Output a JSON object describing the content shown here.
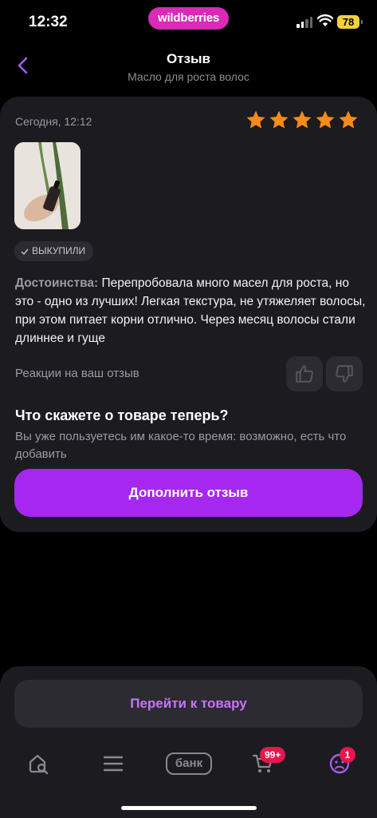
{
  "status_bar": {
    "time": "12:32",
    "brand": "wildberries",
    "battery": "78"
  },
  "header": {
    "title": "Отзыв",
    "subtitle": "Масло для роста волос"
  },
  "review": {
    "date": "Сегодня, 12:12",
    "rating": 5,
    "badge": "ВЫКУПИЛИ",
    "pros_label": "Достоинства:",
    "pros_text": " Перепробовала много масел для роста, но это - одно из лучших! Легкая текстура, не утяжеляет волосы, при этом питает корни отлично. Через месяц волосы стали длиннее и гуще",
    "reactions_label": "Реакции на ваш отзыв"
  },
  "prompt": {
    "title": "Что скажете о товаре теперь?",
    "text": "Вы уже пользуетесь им какое-то время: возможно, есть что добавить",
    "button": "Дополнить отзыв"
  },
  "bottom": {
    "go_to_product": "Перейти к товару",
    "tabs": {
      "bank_label": "банк",
      "cart_badge": "99+",
      "profile_badge": "1"
    }
  },
  "colors": {
    "accent": "#a628f0",
    "brand_pink": "#d92ab8",
    "star": "#f78a1c",
    "badge_red": "#e4174e",
    "card_bg": "#1c1b20"
  }
}
